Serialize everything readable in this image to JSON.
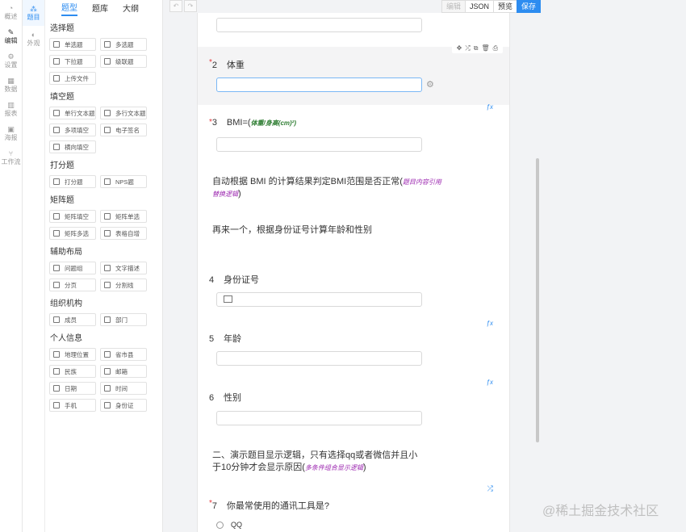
{
  "rail": {
    "items": [
      {
        "label": "概述",
        "icon": "overview-icon"
      },
      {
        "label": "编辑",
        "icon": "edit-icon"
      },
      {
        "label": "设置",
        "icon": "gear-icon"
      },
      {
        "label": "数据",
        "icon": "table-icon"
      },
      {
        "label": "报表",
        "icon": "chart-icon"
      },
      {
        "label": "海报",
        "icon": "image-icon"
      },
      {
        "label": "工作流",
        "icon": "workflow-icon"
      }
    ]
  },
  "rail2": {
    "items": [
      {
        "label": "题目",
        "icon": "grid-icon"
      },
      {
        "label": "外观",
        "icon": "palette-icon"
      }
    ]
  },
  "panel": {
    "tabs": [
      "题型",
      "题库",
      "大纲"
    ],
    "groups": [
      {
        "title": "选择题",
        "items": [
          "单选题",
          "多选题",
          "下拉题",
          "级联题",
          "上传文件"
        ]
      },
      {
        "title": "填空题",
        "items": [
          "单行文本题",
          "多行文本题",
          "多项填空",
          "电子签名",
          "横向填空"
        ]
      },
      {
        "title": "打分题",
        "items": [
          "打分题",
          "NPS题"
        ]
      },
      {
        "title": "矩阵题",
        "items": [
          "矩阵填空",
          "矩阵单选",
          "矩阵多选",
          "表格自增"
        ]
      },
      {
        "title": "辅助布局",
        "items": [
          "问题组",
          "文字描述",
          "分页",
          "分割线"
        ]
      },
      {
        "title": "组织机构",
        "items": [
          "成员",
          "部门"
        ]
      },
      {
        "title": "个人信息",
        "items": [
          "地理位置",
          "省市县",
          "民族",
          "邮箱",
          "日期",
          "时间",
          "手机",
          "身份证"
        ]
      }
    ]
  },
  "toolbar": {
    "undo": "↶",
    "redo": "↷",
    "edit": "编辑",
    "json": "JSON",
    "preview": "预览",
    "save": "保存",
    "accent": "#2d8cf0"
  },
  "canvas": {
    "block_tools": [
      "✥",
      "⤮",
      "⧉",
      "🗑",
      "⎙"
    ],
    "q2": {
      "num": "2",
      "title": "体重"
    },
    "q3": {
      "num": "3",
      "title": "BMI=(",
      "formula": "体重/身高(cm)²)"
    },
    "fx": "ƒx",
    "para1": "自动根据 BMI 的计算结果判定BMI范围是否正常(",
    "para1_note": "题目内容引用替换逻辑",
    "para1_end": ")",
    "para2": "再来一个，根据身份证号计算年龄和性别",
    "q4": {
      "num": "4",
      "title": "身份证号"
    },
    "q5": {
      "num": "5",
      "title": "年龄"
    },
    "q6": {
      "num": "6",
      "title": "性别"
    },
    "para3": "二、演示题目显示逻辑，只有选择qq或者微信并且小于10分钟才会显示原因(",
    "para3_note": "多条件组合显示逻辑",
    "para3_end": ")",
    "logic_icon": "⤮",
    "q7": {
      "num": "7",
      "title": "你最常使用的通讯工具是?"
    },
    "q7_option": "QQ"
  },
  "watermark": "@稀土掘金技术社区"
}
